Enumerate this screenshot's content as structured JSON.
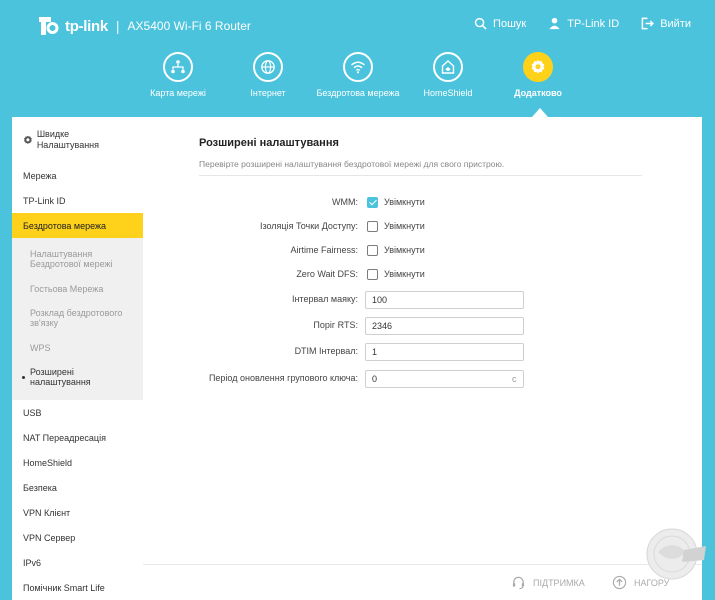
{
  "header": {
    "brand": "tp-link",
    "separator": "|",
    "model": "AX5400 Wi-Fi 6 Router",
    "actions": [
      {
        "label": "Пошук",
        "icon": "search-icon"
      },
      {
        "label": "TP-Link ID",
        "icon": "user-icon"
      },
      {
        "label": "Вийти",
        "icon": "logout-icon"
      }
    ]
  },
  "nav": {
    "items": [
      {
        "label": "Карта мережі",
        "icon": "network-map-icon"
      },
      {
        "label": "Інтернет",
        "icon": "globe-icon"
      },
      {
        "label": "Бездротова мережа",
        "icon": "wifi-icon"
      },
      {
        "label": "HomeShield",
        "icon": "home-shield-icon"
      },
      {
        "label": "Додатково",
        "icon": "gear-icon",
        "active": true
      }
    ]
  },
  "sidebar": {
    "quick_setup": "Швидке Налаштування",
    "items": [
      "Мережа",
      "TP-Link ID",
      "Бездротова мережа"
    ],
    "active_item": "Бездротова мережа",
    "subitems": [
      "Налаштування Бездротової мережі",
      "Гостьова Мережа",
      "Розклад бездротового зв'язку",
      "WPS",
      "Розширені налаштування"
    ],
    "active_subitem": "Розширені налаштування",
    "items_after": [
      "USB",
      "NAT Переадресація",
      "HomeShield",
      "Безпека",
      "VPN Клієнт",
      "VPN Сервер",
      "IPv6",
      "Помічник Smart Life"
    ]
  },
  "content": {
    "title": "Розширені налаштування",
    "description": "Перевірте розширені налаштування бездротової мережі для свого пристрою.",
    "checkbox_rows": [
      {
        "label": "WMM:",
        "option": "Увімкнути",
        "checked": true
      },
      {
        "label": "Ізоляція Точки Доступу:",
        "option": "Увімкнути",
        "checked": false
      },
      {
        "label": "Airtime Fairness:",
        "option": "Увімкнути",
        "checked": false
      },
      {
        "label": "Zero Wait DFS:",
        "option": "Увімкнути",
        "checked": false
      }
    ],
    "fields": [
      {
        "label": "Інтервал маяку:",
        "value": "100",
        "unit": ""
      },
      {
        "label": "Поріг RTS:",
        "value": "2346",
        "unit": ""
      },
      {
        "label": "DTIM Інтервал:",
        "value": "1",
        "unit": ""
      },
      {
        "label": "Період оновлення групового ключа:",
        "value": "0",
        "unit": "с"
      }
    ]
  },
  "footer": {
    "support": "ПІДТРИМКА",
    "top": "НАГОРУ"
  },
  "colors": {
    "header_bg": "#4cc3dc",
    "accent_yellow": "#fed21b",
    "checkbox_blue": "#4cc3dc"
  }
}
